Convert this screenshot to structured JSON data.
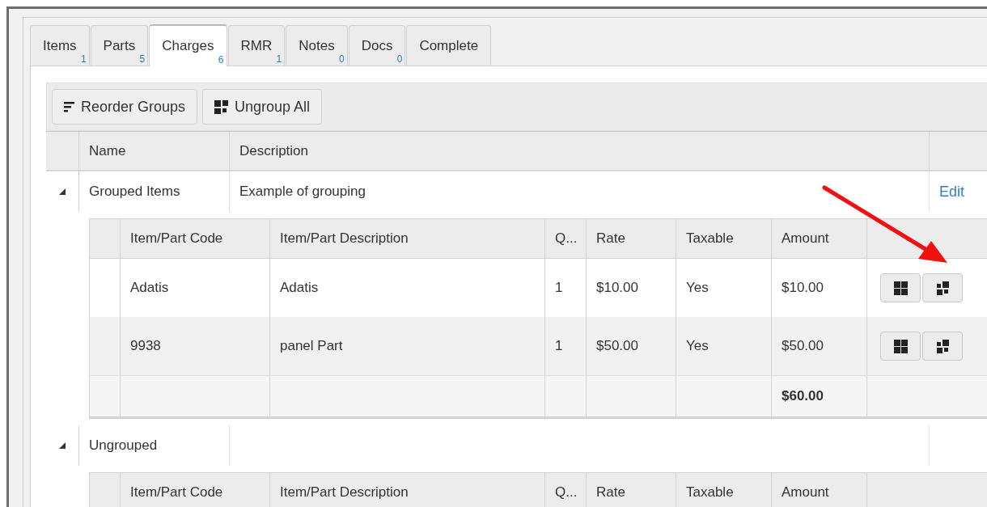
{
  "tabs": [
    {
      "label": "Items",
      "count": "1",
      "selected": false
    },
    {
      "label": "Parts",
      "count": "5",
      "selected": false
    },
    {
      "label": "Charges",
      "count": "6",
      "selected": true
    },
    {
      "label": "RMR",
      "count": "1",
      "selected": false
    },
    {
      "label": "Notes",
      "count": "0",
      "selected": false
    },
    {
      "label": "Docs",
      "count": "0",
      "selected": false
    },
    {
      "label": "Complete",
      "selected": false
    }
  ],
  "toolbar": [
    {
      "label": "Reorder Groups",
      "kind": "reorder"
    },
    {
      "label": "Ungroup All",
      "kind": "ungroup"
    }
  ],
  "groups_table": {
    "columns": [
      "Name",
      "Description"
    ],
    "groups": [
      {
        "name": "Grouped Items",
        "description": "Example of grouping",
        "expanded": true,
        "action": "Edit",
        "items_table": {
          "columns": [
            "Item/Part Code",
            "Item/Part Description",
            "Q...",
            "Rate",
            "Taxable",
            "Amount"
          ],
          "rows": [
            {
              "code": "Adatis",
              "description": "Adatis",
              "qty": "1",
              "rate": "$10.00",
              "taxable": "Yes",
              "amount": "$10.00",
              "actions": [
                {
                  "kind": "group"
                },
                {
                  "kind": "ungroup"
                }
              ]
            },
            {
              "code": "9938",
              "description": "panel Part",
              "qty": "1",
              "rate": "$50.00",
              "taxable": "Yes",
              "amount": "$50.00",
              "actions": [
                {
                  "kind": "group"
                },
                {
                  "kind": "ungroup"
                }
              ]
            }
          ],
          "total": "$60.00"
        }
      },
      {
        "name": "Ungrouped",
        "expanded": true,
        "items_table": {
          "columns": [
            "Item/Part Code",
            "Item/Part Description",
            "Q...",
            "Rate",
            "Taxable",
            "Amount"
          ]
        }
      }
    ]
  },
  "annotation": {
    "kind": "arrow"
  }
}
